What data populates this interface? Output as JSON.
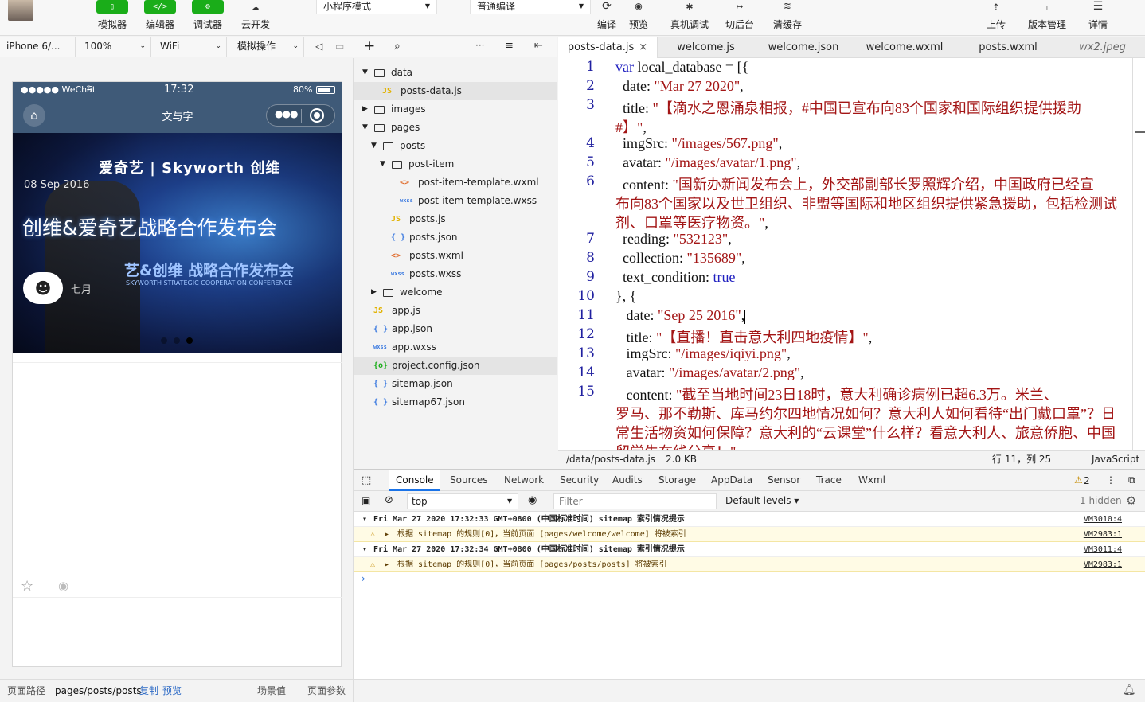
{
  "toolbar": {
    "buttons": [
      {
        "label": "模拟器",
        "icon": "phone-icon"
      },
      {
        "label": "编辑器",
        "icon": "code-icon"
      },
      {
        "label": "调试器",
        "icon": "debug-icon"
      },
      {
        "label": "云开发",
        "icon": "cloud-dev-icon"
      }
    ],
    "mode_select": "小程序模式",
    "compile_select": "普通编译",
    "actions": [
      {
        "label": "编译",
        "icon": "refresh-icon"
      },
      {
        "label": "预览",
        "icon": "eye-icon"
      },
      {
        "label": "真机调试",
        "icon": "bug-icon"
      },
      {
        "label": "切后台",
        "icon": "switch-icon"
      },
      {
        "label": "清缓存",
        "icon": "layers-icon"
      }
    ],
    "right_actions": [
      {
        "label": "上传",
        "icon": "upload-icon"
      },
      {
        "label": "版本管理",
        "icon": "branch-icon"
      },
      {
        "label": "详情",
        "icon": "menu-icon"
      }
    ]
  },
  "simulator": {
    "device": "iPhone 6/...",
    "zoom": "100%",
    "network": "WiFi",
    "ops": "模拟操作",
    "status": {
      "carrier": "●●●●● WeChat",
      "time": "17:32",
      "battery": "80%",
      "battery_level": 0.8
    },
    "nav_title": "文与字",
    "banner": {
      "date": "08 Sep 2016",
      "title": "创维&爱奇艺战略合作发布会",
      "logo_text": "爱奇艺 | Skyworth 创维",
      "sub_text": "艺&创维 战略合作发布会",
      "sub_en": "SKYWORTH STRATEGIC COOPERATION CONFERENCE",
      "author": "七月"
    },
    "dots": 3,
    "active_dot": 2
  },
  "filetree": {
    "items": [
      {
        "name": "data",
        "type": "folder",
        "depth": 0,
        "open": true
      },
      {
        "name": "posts-data.js",
        "type": "js",
        "depth": 1,
        "selected": true
      },
      {
        "name": "images",
        "type": "folder",
        "depth": 0,
        "open": false
      },
      {
        "name": "pages",
        "type": "folder",
        "depth": 0,
        "open": true
      },
      {
        "name": "posts",
        "type": "folder",
        "depth": 1,
        "open": true
      },
      {
        "name": "post-item",
        "type": "folder",
        "depth": 2,
        "open": true
      },
      {
        "name": "post-item-template.wxml",
        "type": "wxml",
        "depth": 3
      },
      {
        "name": "post-item-template.wxss",
        "type": "wxss",
        "depth": 3
      },
      {
        "name": "posts.js",
        "type": "js",
        "depth": 2
      },
      {
        "name": "posts.json",
        "type": "json",
        "depth": 2
      },
      {
        "name": "posts.wxml",
        "type": "wxml",
        "depth": 2
      },
      {
        "name": "posts.wxss",
        "type": "wxss",
        "depth": 2
      },
      {
        "name": "welcome",
        "type": "folder",
        "depth": 1,
        "open": false
      },
      {
        "name": "app.js",
        "type": "js",
        "depth": 0
      },
      {
        "name": "app.json",
        "type": "json",
        "depth": 0
      },
      {
        "name": "app.wxss",
        "type": "wxss",
        "depth": 0
      },
      {
        "name": "project.config.json",
        "type": "config",
        "depth": 0,
        "hover": true
      },
      {
        "name": "sitemap.json",
        "type": "json",
        "depth": 0
      },
      {
        "name": "sitemap67.json",
        "type": "json",
        "depth": 0
      }
    ]
  },
  "editor": {
    "tabs": [
      {
        "label": "posts-data.js",
        "active": true,
        "close": "×"
      },
      {
        "label": "welcome.js"
      },
      {
        "label": "welcome.json"
      },
      {
        "label": "welcome.wxml"
      },
      {
        "label": "posts.wxml"
      },
      {
        "label": "wx2.jpeg",
        "italic": true
      }
    ],
    "lines": [
      {
        "n": "1",
        "parts": [
          {
            "t": "var",
            "c": "kw"
          },
          {
            "t": " local_database = [{"
          }
        ]
      },
      {
        "n": "2",
        "parts": [
          {
            "t": "  date: "
          },
          {
            "t": "\"Mar 27 2020\"",
            "c": "str"
          },
          {
            "t": ","
          }
        ]
      },
      {
        "n": "3",
        "parts": [
          {
            "t": "  title: "
          },
          {
            "t": "\"【滴水之恩涌泉相报，#中国已宣布向83个国家和国际组织提供援助",
            "c": "str"
          }
        ]
      },
      {
        "n": "",
        "parts": [
          {
            "t": "#】\"",
            "c": "str"
          },
          {
            "t": ","
          }
        ]
      },
      {
        "n": "4",
        "parts": [
          {
            "t": "  imgSrc: "
          },
          {
            "t": "\"/images/567.png\"",
            "c": "str"
          },
          {
            "t": ","
          }
        ]
      },
      {
        "n": "5",
        "parts": [
          {
            "t": "  avatar: "
          },
          {
            "t": "\"/images/avatar/1.png\"",
            "c": "str"
          },
          {
            "t": ","
          }
        ]
      },
      {
        "n": "6",
        "parts": [
          {
            "t": "  content: "
          },
          {
            "t": "\"国新办新闻发布会上，外交部副部长罗照辉介绍，中国政府已经宣",
            "c": "str"
          }
        ]
      },
      {
        "n": "",
        "parts": [
          {
            "t": "布向83个国家以及世卫组织、非盟等国际和地区组织提供紧急援助，包括检测试",
            "c": "str"
          }
        ]
      },
      {
        "n": "",
        "parts": [
          {
            "t": "剂、口罩等医疗物资。\"",
            "c": "str"
          },
          {
            "t": ","
          }
        ]
      },
      {
        "n": "7",
        "parts": [
          {
            "t": "  reading: "
          },
          {
            "t": "\"532123\"",
            "c": "str"
          },
          {
            "t": ","
          }
        ]
      },
      {
        "n": "8",
        "parts": [
          {
            "t": "  collection: "
          },
          {
            "t": "\"135689\"",
            "c": "str"
          },
          {
            "t": ","
          }
        ]
      },
      {
        "n": "9",
        "parts": [
          {
            "t": "  text_condition: "
          },
          {
            "t": "true",
            "c": "kw"
          }
        ]
      },
      {
        "n": "10",
        "parts": [
          {
            "t": "}, {"
          }
        ]
      },
      {
        "n": "11",
        "parts": [
          {
            "t": "   date: "
          },
          {
            "t": "\"Sep 25 2016\"",
            "c": "str"
          },
          {
            "t": ","
          }
        ],
        "cursor": true
      },
      {
        "n": "12",
        "parts": [
          {
            "t": "   title: "
          },
          {
            "t": "\"【直播！直击意大利四地疫情】\"",
            "c": "str"
          },
          {
            "t": ","
          }
        ]
      },
      {
        "n": "13",
        "parts": [
          {
            "t": "   imgSrc: "
          },
          {
            "t": "\"/images/iqiyi.png\"",
            "c": "str"
          },
          {
            "t": ","
          }
        ]
      },
      {
        "n": "14",
        "parts": [
          {
            "t": "   avatar: "
          },
          {
            "t": "\"/images/avatar/2.png\"",
            "c": "str"
          },
          {
            "t": ","
          }
        ]
      },
      {
        "n": "15",
        "parts": [
          {
            "t": "   content: "
          },
          {
            "t": "\"截至当地时间23日18时，意大利确诊病例已超6.3万。米兰、",
            "c": "str"
          }
        ]
      },
      {
        "n": "",
        "parts": [
          {
            "t": "罗马、那不勒斯、库马约尔四地情况如何？意大利人如何看待“出门戴口罩”？日",
            "c": "str"
          }
        ]
      },
      {
        "n": "",
        "parts": [
          {
            "t": "常生活物资如何保障？意大利的“云课堂”什么样？看意大利人、旅意侨胞、中国",
            "c": "str"
          }
        ]
      },
      {
        "n": "",
        "parts": [
          {
            "t": "留学生在线分享！\"",
            "c": "str"
          }
        ]
      }
    ],
    "status": {
      "path": "/data/posts-data.js",
      "size": "2.0 KB",
      "position": "行 11，列 25",
      "language": "JavaScript"
    }
  },
  "devtools": {
    "tabs": [
      "Console",
      "Sources",
      "Network",
      "Security",
      "Audits",
      "Storage",
      "AppData",
      "Sensor",
      "Trace",
      "Wxml"
    ],
    "active_tab": "Console",
    "warning_count": "2",
    "context": "top",
    "filter_placeholder": "Filter",
    "levels": "Default levels ▾",
    "hidden": "1 hidden",
    "messages": [
      {
        "kind": "group",
        "text": "Fri Mar 27 2020 17:32:33 GMT+0800 (中国标准时间) sitemap 索引情况提示",
        "src": "VM3010:4"
      },
      {
        "kind": "warn",
        "text": "根据 sitemap 的规则[0]，当前页面 [pages/welcome/welcome] 将被索引",
        "src": "VM2983:1"
      },
      {
        "kind": "group",
        "text": "Fri Mar 27 2020 17:32:34 GMT+0800 (中国标准时间) sitemap 索引情况提示",
        "src": "VM3011:4"
      },
      {
        "kind": "warn",
        "text": "根据 sitemap 的规则[0]，当前页面 [pages/posts/posts] 将被索引",
        "src": "VM2983:1"
      }
    ],
    "prompt": "›"
  },
  "bottombar": {
    "path_label": "页面路径",
    "path": "pages/posts/posts",
    "copy": "复制",
    "preview": "预览",
    "scene": "场景值",
    "params": "页面参数"
  },
  "colors": {
    "accent": "#1aad19",
    "nav": "#3f5a78",
    "string": "#a31515",
    "keyword": "#2020c0"
  }
}
